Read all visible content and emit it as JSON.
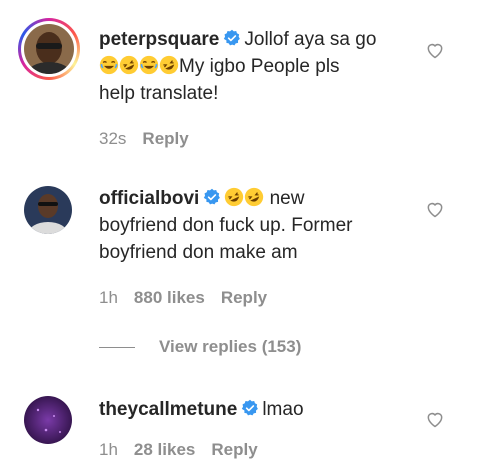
{
  "comments": [
    {
      "username": "peterpsquare",
      "verified": true,
      "text_line1": "Jollof aya sa go",
      "text_line2_after_emojis": "My igbo People pls",
      "text_line3": "help translate!",
      "emojis": [
        "joy-emoji",
        "rofl-emoji",
        "joy-emoji",
        "rofl-emoji"
      ],
      "time": "32s",
      "reply_label": "Reply"
    },
    {
      "username": "officialbovi",
      "verified": true,
      "emojis": [
        "rofl-emoji",
        "rofl-emoji"
      ],
      "text_line1": "new",
      "text_line2": "boyfriend don fuck up. Former",
      "text_line3": "boyfriend don make am",
      "time": "1h",
      "likes": "880 likes",
      "reply_label": "Reply",
      "view_replies": "View replies (153)"
    },
    {
      "username": "theycallmetune",
      "verified": true,
      "text_line1": "lmao",
      "time": "1h",
      "likes": "28 likes",
      "reply_label": "Reply"
    }
  ],
  "colors": {
    "text": "#262626",
    "secondary": "#8e8e8e",
    "verified_blue": "#3897f0"
  },
  "icons": [
    "heart-outline-icon",
    "verified-badge-icon"
  ]
}
